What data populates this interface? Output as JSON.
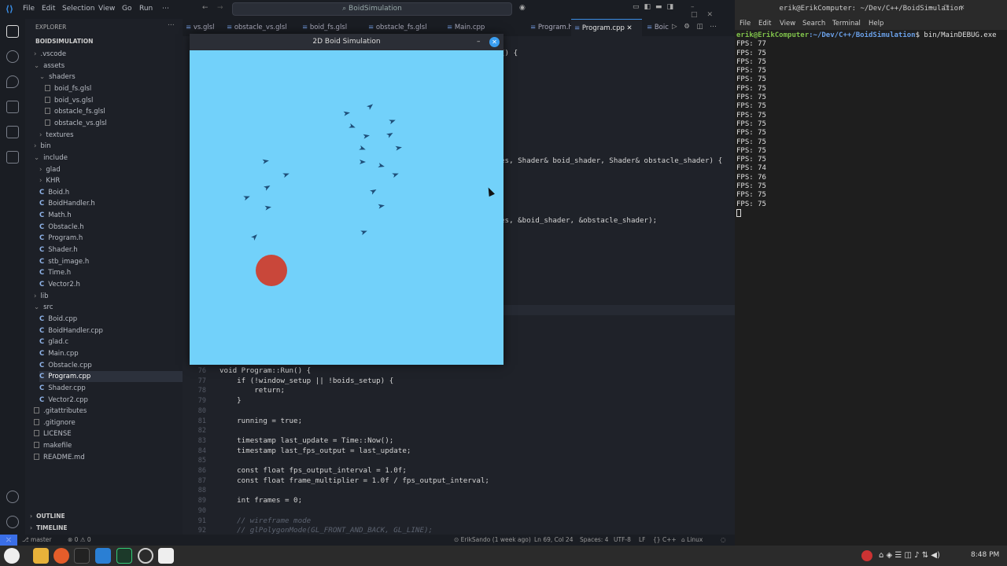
{
  "vscode": {
    "menu": [
      "File",
      "Edit",
      "Selection",
      "View",
      "Go",
      "Run",
      "⋯"
    ],
    "search_placeholder": "BoidSimulation",
    "explorer_title": "EXPLORER",
    "project": "BOIDSIMULATION",
    "tree": [
      {
        "label": ".vscode",
        "kind": "folder",
        "depth": 1,
        "open": false
      },
      {
        "label": "assets",
        "kind": "folder",
        "depth": 1,
        "open": true
      },
      {
        "label": "shaders",
        "kind": "folder",
        "depth": 2,
        "open": true
      },
      {
        "label": "boid_fs.glsl",
        "kind": "file",
        "depth": 3
      },
      {
        "label": "boid_vs.glsl",
        "kind": "file",
        "depth": 3
      },
      {
        "label": "obstacle_fs.glsl",
        "kind": "file",
        "depth": 3
      },
      {
        "label": "obstacle_vs.glsl",
        "kind": "file",
        "depth": 3
      },
      {
        "label": "textures",
        "kind": "folder",
        "depth": 2,
        "open": false
      },
      {
        "label": "bin",
        "kind": "folder",
        "depth": 1,
        "open": false
      },
      {
        "label": "include",
        "kind": "folder",
        "depth": 1,
        "open": true
      },
      {
        "label": "glad",
        "kind": "folder",
        "depth": 2,
        "open": false
      },
      {
        "label": "KHR",
        "kind": "folder",
        "depth": 2,
        "open": false
      },
      {
        "label": "Boid.h",
        "kind": "c",
        "depth": 2
      },
      {
        "label": "BoidHandler.h",
        "kind": "c",
        "depth": 2
      },
      {
        "label": "Math.h",
        "kind": "c",
        "depth": 2
      },
      {
        "label": "Obstacle.h",
        "kind": "c",
        "depth": 2
      },
      {
        "label": "Program.h",
        "kind": "c",
        "depth": 2
      },
      {
        "label": "Shader.h",
        "kind": "c",
        "depth": 2
      },
      {
        "label": "stb_image.h",
        "kind": "c",
        "depth": 2
      },
      {
        "label": "Time.h",
        "kind": "c",
        "depth": 2
      },
      {
        "label": "Vector2.h",
        "kind": "c",
        "depth": 2
      },
      {
        "label": "lib",
        "kind": "folder",
        "depth": 1,
        "open": false
      },
      {
        "label": "src",
        "kind": "folder",
        "depth": 1,
        "open": true
      },
      {
        "label": "Boid.cpp",
        "kind": "c",
        "depth": 2
      },
      {
        "label": "BoidHandler.cpp",
        "kind": "c",
        "depth": 2
      },
      {
        "label": "glad.c",
        "kind": "c",
        "depth": 2
      },
      {
        "label": "Main.cpp",
        "kind": "c",
        "depth": 2
      },
      {
        "label": "Obstacle.cpp",
        "kind": "c",
        "depth": 2
      },
      {
        "label": "Program.cpp",
        "kind": "c",
        "depth": 2,
        "selected": true
      },
      {
        "label": "Shader.cpp",
        "kind": "c",
        "depth": 2
      },
      {
        "label": "Vector2.cpp",
        "kind": "c",
        "depth": 2
      },
      {
        "label": ".gitattributes",
        "kind": "file",
        "depth": 1
      },
      {
        "label": ".gitignore",
        "kind": "file",
        "depth": 1
      },
      {
        "label": "LICENSE",
        "kind": "file",
        "depth": 1
      },
      {
        "label": "makefile",
        "kind": "file",
        "depth": 1
      },
      {
        "label": "README.md",
        "kind": "file",
        "depth": 1
      }
    ],
    "outline": "OUTLINE",
    "timeline": "TIMELINE",
    "tabs": [
      {
        "label": "vs.glsl",
        "active": false
      },
      {
        "label": "obstacle_vs.glsl",
        "active": false
      },
      {
        "label": "boid_fs.glsl",
        "active": false
      },
      {
        "label": "obstacle_fs.glsl",
        "active": false
      },
      {
        "label": "Main.cpp",
        "active": false
      },
      {
        "label": "Program.h",
        "active": false
      },
      {
        "label": "Program.cpp",
        "active": true
      },
      {
        "label": "Boic",
        "active": false
      }
    ],
    "code_fragments": [
      {
        "text": "{) {",
        "line": "top"
      },
      {
        "text": "es, Shader& boid_shader, Shader& obstacle_shader) {",
        "line": "mid1"
      },
      {
        "text": "es, &boid_shader, &obstacle_shader);",
        "line": "mid2"
      }
    ],
    "code_lines": [
      {
        "num": "76",
        "text": "void Program::Run() {"
      },
      {
        "num": "77",
        "text": "    if (!window_setup || !boids_setup) {"
      },
      {
        "num": "78",
        "text": "        return;"
      },
      {
        "num": "79",
        "text": "    }"
      },
      {
        "num": "80",
        "text": ""
      },
      {
        "num": "81",
        "text": "    running = true;"
      },
      {
        "num": "82",
        "text": ""
      },
      {
        "num": "83",
        "text": "    timestamp last_update = Time::Now();"
      },
      {
        "num": "84",
        "text": "    timestamp last_fps_output = last_update;"
      },
      {
        "num": "85",
        "text": ""
      },
      {
        "num": "86",
        "text": "    const float fps_output_interval = 1.0f;"
      },
      {
        "num": "87",
        "text": "    const float frame_multiplier = 1.0f / fps_output_interval;"
      },
      {
        "num": "88",
        "text": ""
      },
      {
        "num": "89",
        "text": "    int frames = 0;"
      },
      {
        "num": "90",
        "text": ""
      },
      {
        "num": "91",
        "text": "    // wireframe mode"
      },
      {
        "num": "92",
        "text": "    // glPolygonMode(GL_FRONT_AND_BACK, GL_LINE);"
      }
    ],
    "status": {
      "branch": "master",
      "problems": "⊗ 0 ⚠ 0",
      "blame": "ErikSando (1 week ago)",
      "position": "Ln 69, Col 24",
      "spaces": "Spaces: 4",
      "encoding": "UTF-8",
      "eol": "LF",
      "lang": "C++",
      "os": "Linux"
    }
  },
  "boid_window": {
    "title": "2D Boid Simulation",
    "minimize": "–",
    "close": "✕",
    "colors": {
      "background": "#72d1fa",
      "boid": "#1e4e78",
      "obstacle": "#c9473a"
    }
  },
  "terminal": {
    "title": "erik@ErikComputer: ~/Dev/C++/BoidSimulation",
    "menu": [
      "File",
      "Edit",
      "View",
      "Search",
      "Terminal",
      "Help"
    ],
    "prompt_user": "erik@ErikComputer",
    "prompt_path": ":~/Dev/C++/BoidSimulation",
    "command": "$ bin/MainDEBUG.exe",
    "output": [
      "FPS: 77",
      "FPS: 75",
      "FPS: 75",
      "FPS: 75",
      "FPS: 75",
      "FPS: 75",
      "FPS: 75",
      "FPS: 75",
      "FPS: 75",
      "FPS: 75",
      "FPS: 75",
      "FPS: 75",
      "FPS: 75",
      "FPS: 75",
      "FPS: 74",
      "FPS: 76",
      "FPS: 75",
      "FPS: 75",
      "FPS: 75"
    ]
  },
  "taskbar": {
    "clock": "8:48 PM"
  }
}
